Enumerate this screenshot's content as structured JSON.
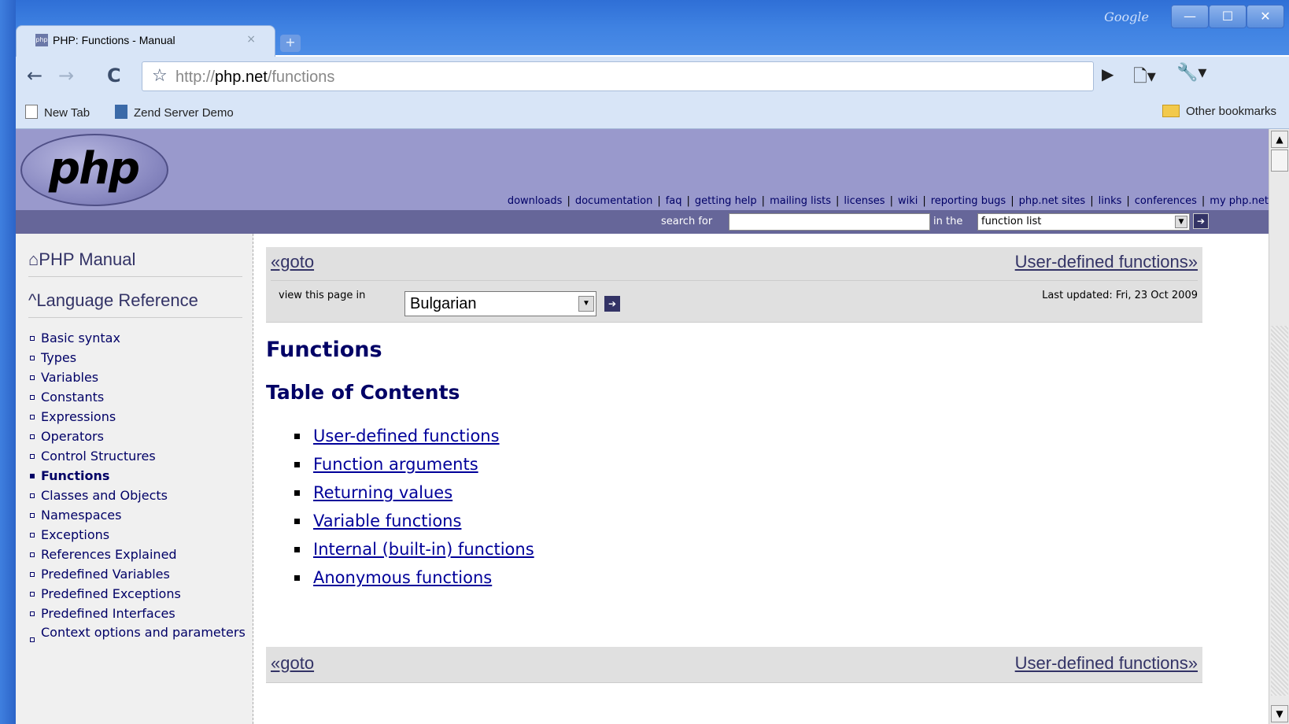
{
  "browser": {
    "titlebar_brand": "Google",
    "window_buttons": {
      "minimize": "—",
      "maximize": "☐",
      "close": "✕"
    },
    "tab": {
      "title": "PHP: Functions - Manual",
      "favicon": "php",
      "close": "×"
    },
    "new_tab": "+",
    "toolbar": {
      "back_icon": "←",
      "forward_icon": "→",
      "reload_icon": "C",
      "star_icon": "☆",
      "url_scheme": "http://",
      "url_host": "php.net",
      "url_path": "/functions",
      "page_menu_icon": "▶",
      "page_doc_icon": "🗋▾",
      "wrench_icon": "🔧▾"
    },
    "bookmarks": [
      {
        "label": "New Tab"
      },
      {
        "label": "Zend Server Demo"
      }
    ],
    "other_bookmarks": "Other bookmarks",
    "scrollbar": {
      "up": "▲",
      "down": "▼"
    }
  },
  "php_header": {
    "logo": "php",
    "nav": [
      "downloads",
      "documentation",
      "faq",
      "getting help",
      "mailing lists",
      "licenses",
      "wiki",
      "reporting bugs",
      "php.net sites",
      "links",
      "conferences",
      "my php.net"
    ],
    "search_label": "search for",
    "search_value": "",
    "in_the_label": "in the",
    "search_scope": "function list",
    "select_arrow": "▼",
    "go_icon": "➔"
  },
  "sidebar": {
    "manual": "⌂PHP Manual",
    "language_reference": "^Language Reference",
    "items": [
      {
        "label": "Basic syntax"
      },
      {
        "label": "Types"
      },
      {
        "label": "Variables"
      },
      {
        "label": "Constants"
      },
      {
        "label": "Expressions"
      },
      {
        "label": "Operators"
      },
      {
        "label": "Control Structures"
      },
      {
        "label": "Functions",
        "active": true
      },
      {
        "label": "Classes and Objects"
      },
      {
        "label": "Namespaces"
      },
      {
        "label": "Exceptions"
      },
      {
        "label": "References Explained"
      },
      {
        "label": "Predefined Variables"
      },
      {
        "label": "Predefined Exceptions"
      },
      {
        "label": "Predefined Interfaces"
      },
      {
        "label": "Context options and parameters"
      }
    ]
  },
  "main": {
    "prev_link": "«goto",
    "next_link": "User-defined functions»",
    "view_label": "view this page in",
    "language": "Bulgarian",
    "last_updated": "Last updated: Fri, 23 Oct 2009",
    "title": "Functions",
    "toc_heading": "Table of Contents",
    "toc": [
      "User-defined functions",
      "Function arguments",
      "Returning values",
      "Variable functions",
      "Internal (built-in) functions",
      "Anonymous functions"
    ]
  },
  "colors": {
    "php_header_bg": "#9999cc",
    "php_searchbar_bg": "#666699",
    "link_color": "#000099",
    "heading_color": "#000066"
  }
}
